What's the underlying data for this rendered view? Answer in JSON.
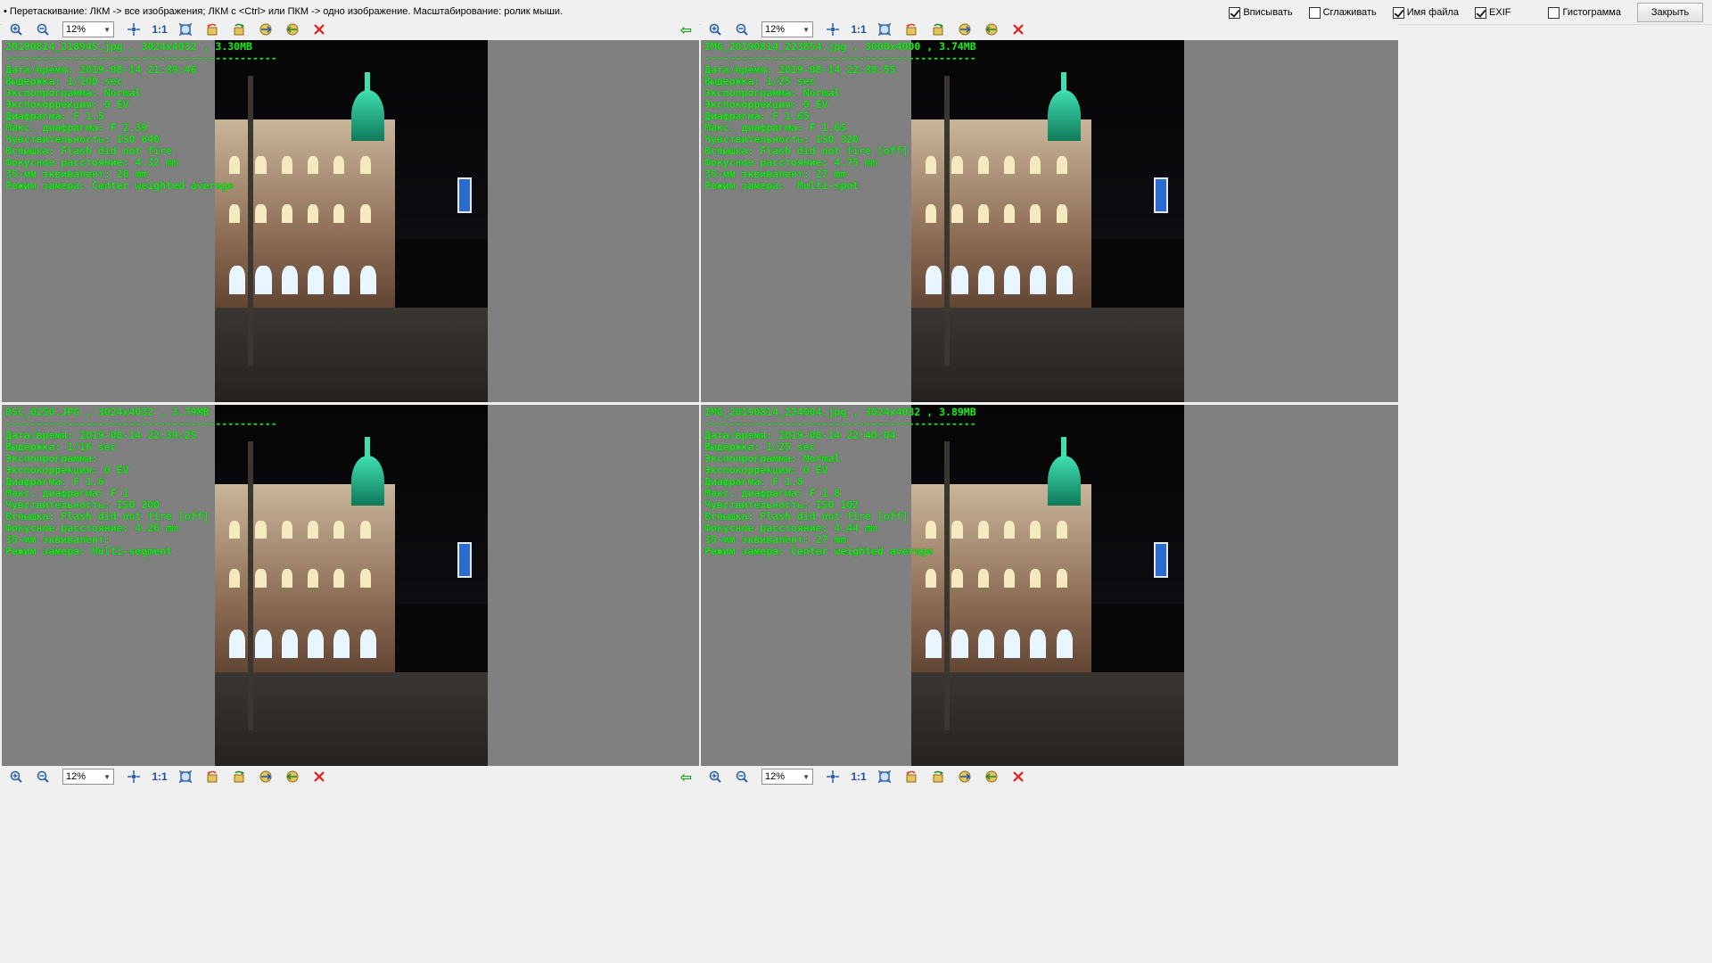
{
  "hint": "• Перетаскивание: ЛКМ -> все изображения; ЛКМ с <Ctrl> или ПКМ -> одно изображение. Масштабирование: ролик мыши.",
  "options": [
    {
      "label": "Вписывать",
      "checked": true
    },
    {
      "label": "Сглаживать",
      "checked": false
    },
    {
      "label": "Имя файла",
      "checked": true
    },
    {
      "label": "EXIF",
      "checked": true
    },
    {
      "label": "Гистограмма",
      "checked": false
    }
  ],
  "close_label": "Закрыть",
  "toolbar": {
    "zoom_value": "12%",
    "one_to_one": "1:1"
  },
  "separator": "--------------------------------------------",
  "images": [
    {
      "header": "20190814_218945.jpg , 3024x4032 , 3.30MB",
      "exif": [
        "Дата/время: 2019-08-14 21:39:46",
        "Выдержка: 1/100 sec",
        "Экспопрограмма: Normal",
        "Экспокоррекция: 0 EV",
        "Диафрагма: F 1.5",
        "Макс. диафрагма: F 2.39",
        "Чувствительность: ISO 640",
        "Вспышка: Flash did not fire",
        "Фокусное расстояние: 4.32 mm",
        "35-мм эквивалент: 26 mm",
        "Режим замера: Center weighted average"
      ]
    },
    {
      "header": "IMG_20190814_223854.jpg , 3000x4000 , 3.74MB",
      "exif": [
        "Дата/время: 2019-08-14 22:38:55",
        "Выдержка: 1/25 sec",
        "Экспопрограмма: Normal",
        "Экспокоррекция: 0 EV",
        "Диафрагма: F 1.65",
        "Макс. диафрагма: F 1.65",
        "Чувствительность: ISO 320",
        "Вспышка: Flash did not fire [off]",
        "Фокусное расстояние: 4.75 mm",
        "35-мм эквивалент: 27 mm",
        "Режим замера:  Multi-spot"
      ]
    },
    {
      "header": "DSC_0250.JPG , 3024x4032 , 3.79MB",
      "exif": [
        "Дата/время: 2019-08-14 22:39:25",
        "Выдержка: 1/16 sec",
        "Экспопрограмма:",
        "Экспокоррекция: 0 EV",
        "Диафрагма: F 1.6",
        "Макс. диафрагма: F 1",
        "Чувствительность: ISO 200",
        "Вспышка: Flash did not fire [off]",
        "Фокусное расстояние: 4.26 mm",
        "35-мм эквивалент:",
        "Режим замера: Multi-segment"
      ]
    },
    {
      "header": "IMG_20190814_224004.jpg , 3024x4032 , 3.89MB",
      "exif": [
        "Дата/время: 2019-08-14 22:40:04",
        "Выдержка: 1/25 sec",
        "Экспопрограмма: Normal",
        "Экспокоррекция: 0 EV",
        "Диафрагма: F 1.8",
        "Макс. диафрагма: F 1.8",
        "Чувствительность: ISO 102",
        "Вспышка: Flash did not fire [off]",
        "Фокусное расстояние: 4.44 mm",
        "35-мм эквивалент: 27 mm",
        "Режим замера: Center weighted average"
      ]
    }
  ],
  "colors": {
    "exif_text": "#1de31d",
    "pane_bg": "#808080",
    "toolbar_bg": "#f0f0f0",
    "delete_icon": "#e21d1d",
    "back_arrow": "#1aa01a"
  }
}
